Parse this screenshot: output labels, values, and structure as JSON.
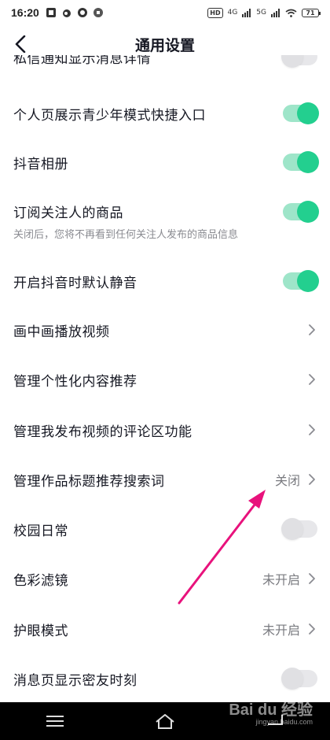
{
  "status_bar": {
    "time": "16:20",
    "network_hd": "HD",
    "signal_1": "4G",
    "signal_2": "5G",
    "battery": "71"
  },
  "header": {
    "title": "通用设置"
  },
  "settings": [
    {
      "label": "私信通知显示消息详情",
      "control": "toggle",
      "state": "off"
    },
    {
      "label": "个人页展示青少年模式快捷入口",
      "control": "toggle",
      "state": "on"
    },
    {
      "label": "抖音相册",
      "control": "toggle",
      "state": "on"
    },
    {
      "label": "订阅关注人的商品",
      "sub": "关闭后，您将不再看到任何关注人发布的商品信息",
      "control": "toggle",
      "state": "on"
    },
    {
      "label": "开启抖音时默认静音",
      "control": "toggle",
      "state": "on"
    },
    {
      "label": "画中画播放视频",
      "control": "chevron"
    },
    {
      "label": "管理个性化内容推荐",
      "control": "chevron"
    },
    {
      "label": "管理我发布视频的评论区功能",
      "control": "chevron"
    },
    {
      "label": "管理作品标题推荐搜索词",
      "value": "关闭",
      "control": "chevron"
    },
    {
      "label": "校园日常",
      "control": "toggle",
      "state": "off"
    },
    {
      "label": "色彩滤镜",
      "value": "未开启",
      "control": "chevron"
    },
    {
      "label": "护眼模式",
      "value": "未开启",
      "control": "chevron"
    },
    {
      "label": "消息页显示密友时刻",
      "control": "toggle",
      "state": "off"
    }
  ],
  "watermark": {
    "brand": "Bai du 经验",
    "url": "jingyan.baidu.com"
  },
  "colors": {
    "toggle_on": "#23cf8f",
    "toggle_on_track": "#9ee5c9",
    "toggle_off": "#e0e0e3",
    "annotation_arrow": "#e8127c"
  }
}
